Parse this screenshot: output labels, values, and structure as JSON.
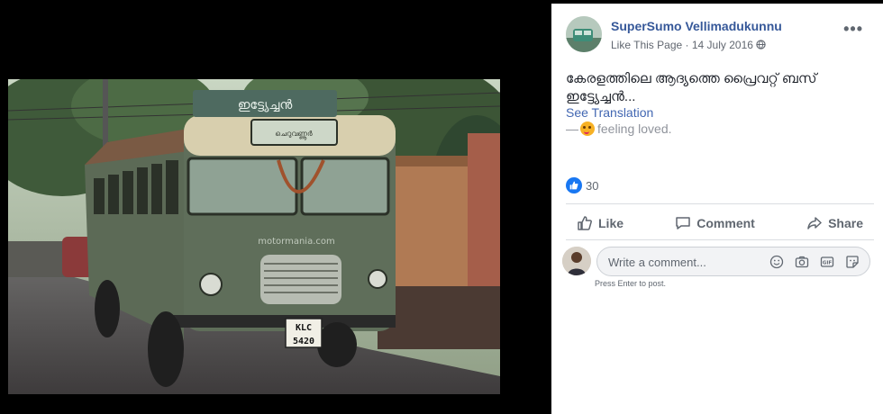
{
  "post": {
    "page_name": "SuperSumo Vellimadukunnu",
    "like_page": "Like This Page",
    "date": "14 July 2016",
    "separator": "·",
    "text_line1": "കേരളത്തിലെ ആദ്യത്തെ പ്രൈവറ്റ് ബസ്",
    "text_line2": "ഇട്ട്യേച്ചൻ...",
    "see_translation": "See Translation",
    "feeling_prefix": "—",
    "feeling_text": "feeling loved.",
    "more_label": "•••"
  },
  "photo": {
    "board_text": "ഇട്ട്യേച്ചൻ",
    "route_text": "ചെറുവണ്ണൂർ",
    "watermark": "motormania.com",
    "plate_line1": "KLC",
    "plate_line2": "5420"
  },
  "reactions": {
    "icon": "like-icon",
    "count": "30"
  },
  "actions": {
    "like": "Like",
    "comment": "Comment",
    "share": "Share"
  },
  "comment": {
    "placeholder": "Write a comment...",
    "hint": "Press Enter to post.",
    "icons": [
      "emoji-icon",
      "camera-icon",
      "gif-icon",
      "sticker-icon"
    ]
  },
  "colors": {
    "link": "#365899",
    "like_blue": "#1877f2"
  }
}
